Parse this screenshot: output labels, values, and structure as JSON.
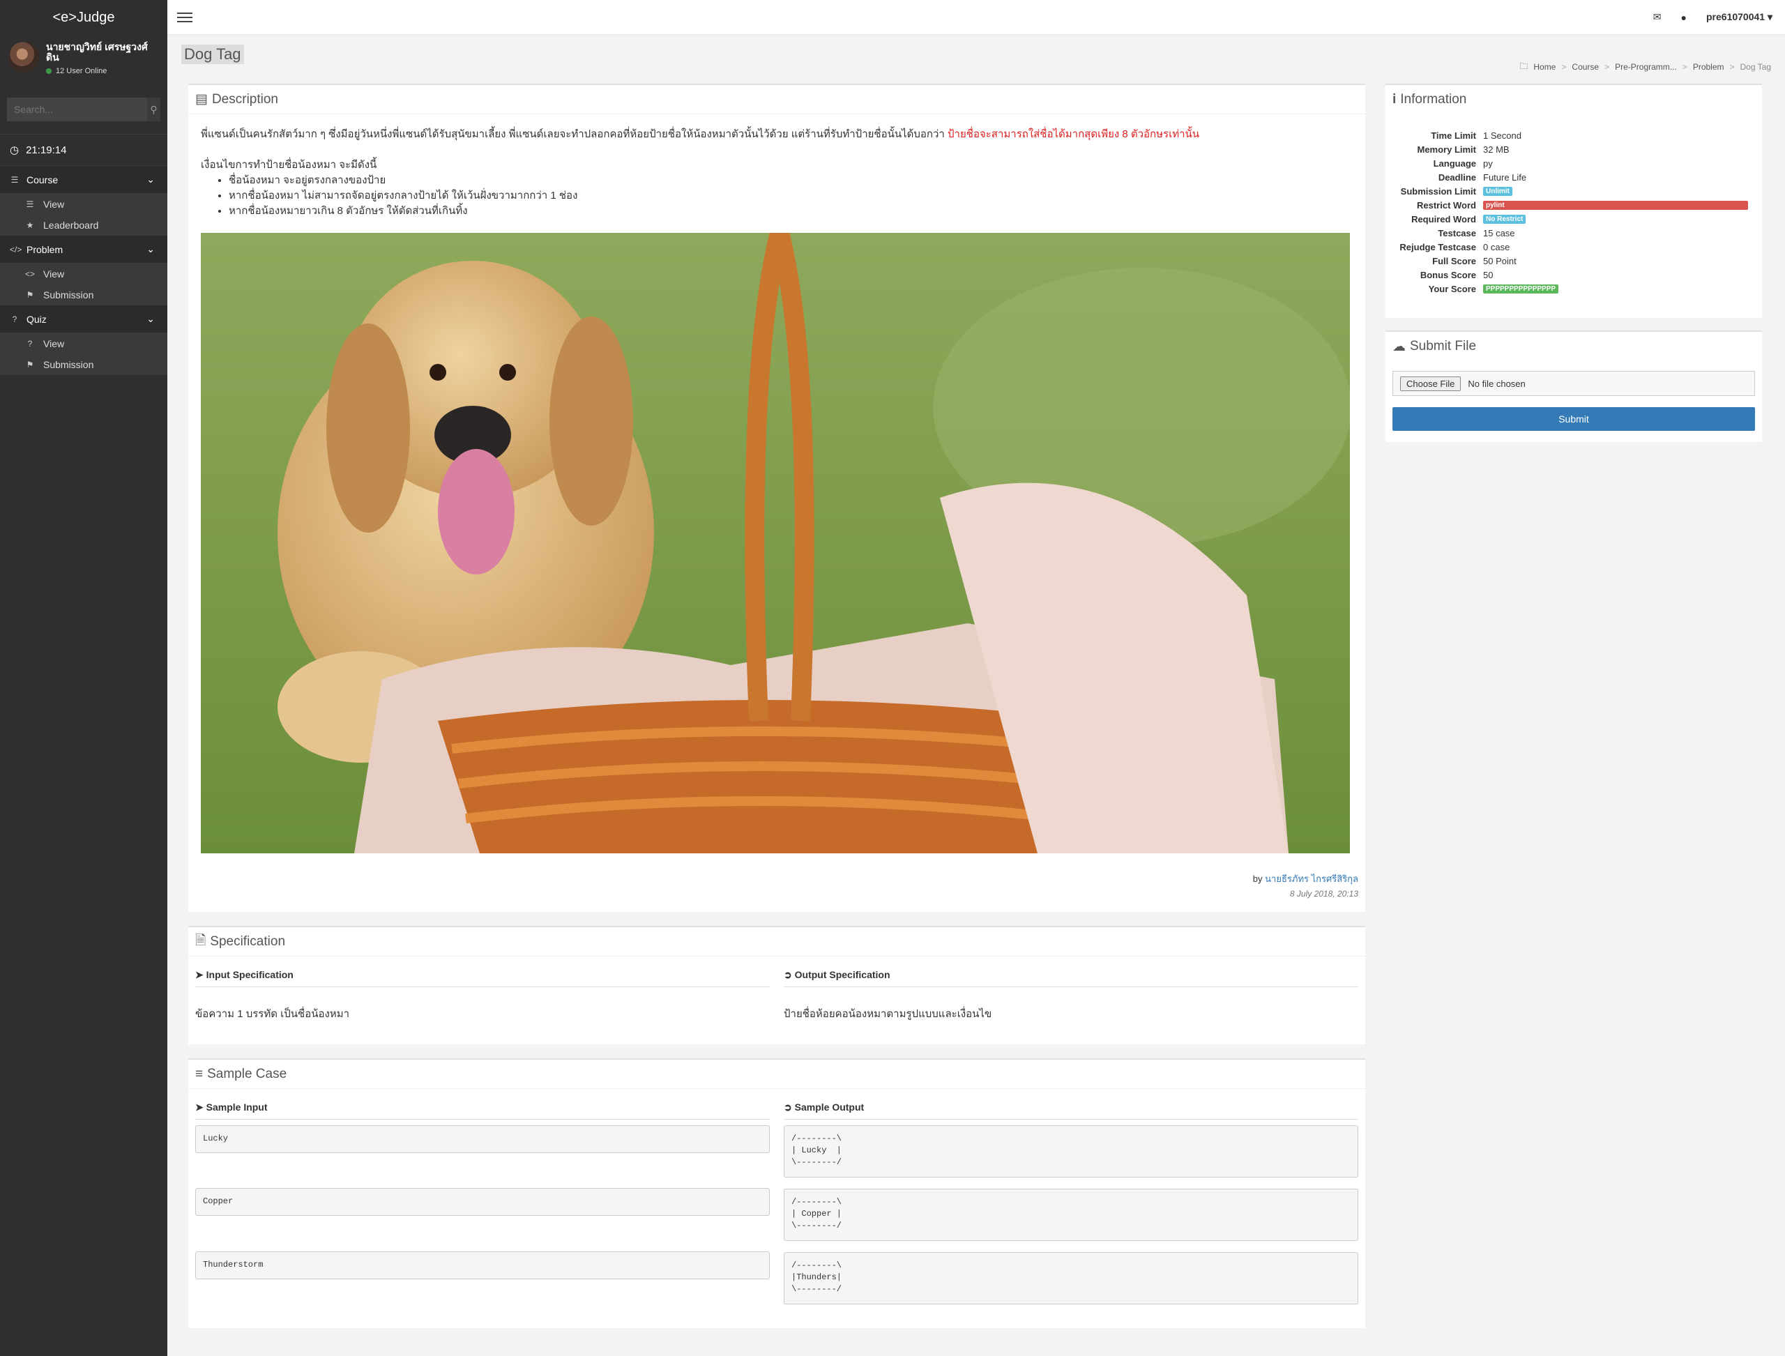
{
  "app": {
    "logo": "<e>Judge",
    "user_name": "นายชาญวิทย์ เศรษฐวงศ์ดิน",
    "online": "12 User Online",
    "search_placeholder": "Search...",
    "clock": "21:19:14"
  },
  "sidebar": {
    "groups": [
      {
        "label": "Course",
        "items": [
          "View",
          "Leaderboard"
        ]
      },
      {
        "label": "Problem",
        "items": [
          "View",
          "Submission"
        ]
      },
      {
        "label": "Quiz",
        "items": [
          "View",
          "Submission"
        ]
      }
    ]
  },
  "topbar": {
    "user": "pre61070041"
  },
  "page": {
    "title": "Dog Tag",
    "breadcrumb": [
      "Home",
      "Course",
      "Pre-Programm...",
      "Problem",
      "Dog Tag"
    ]
  },
  "description": {
    "heading": "Description",
    "intro": "พี่แซนด์เป็นคนรักสัตว์มาก ๆ ซึ่งมีอยู่วันหนึ่งพี่แซนด์ได้รับสุนัขมาเลี้ยง พี่แซนด์เลยจะทำปลอกคอที่ห้อยป้ายชื่อให้น้องหมาตัวนั้นไว้ด้วย แต่ร้านที่รับทำป้ายชื่อนั้นได้บอกว่า",
    "intro_red": "ป้ายชื่อจะสามารถใส่ชื่อได้มากสุดเพียง 8 ตัวอักษรเท่านั้น",
    "cond_title": "เงื่อนไขการทำป้ายชื่อน้องหมา จะมีดังนี้",
    "rules": [
      "ชื่อน้องหมา จะอยู่ตรงกลางของป้าย",
      "หากชื่อน้องหมา ไม่สามารถจัดอยู่ตรงกลางป้ายได้ ให้เว้นฝั่งขวามากกว่า 1 ช่อง",
      "หากชื่อน้องหมายาวเกิน 8 ตัวอักษร ให้ตัดส่วนที่เกินทิ้ง"
    ],
    "by": "by",
    "author": "นายธีรภัทร ไกรศรีสิริกุล",
    "date": "8 July 2018, 20:13"
  },
  "specification": {
    "heading": "Specification",
    "input_title": "Input Specification",
    "output_title": "Output Specification",
    "input_text": "ข้อความ 1 บรรทัด เป็นชื่อน้องหมา",
    "output_text": "ป้ายชื่อห้อยคอน้องหมาตามรูปแบบและเงื่อนไข"
  },
  "samples": {
    "heading": "Sample Case",
    "input_title": "Sample Input",
    "output_title": "Sample Output",
    "cases": [
      {
        "input": "Lucky",
        "output": "/--------\\\n| Lucky  |\n\\--------/"
      },
      {
        "input": "Copper",
        "output": "/--------\\\n| Copper |\n\\--------/"
      },
      {
        "input": "Thunderstorm",
        "output": "/--------\\\n|Thunders|\n\\--------/"
      }
    ]
  },
  "information": {
    "heading": "Information",
    "rows": [
      {
        "k": "Time Limit",
        "v": "1 Second"
      },
      {
        "k": "Memory Limit",
        "v": "32 MB"
      },
      {
        "k": "Language",
        "v": "py"
      },
      {
        "k": "Deadline",
        "v": "Future Life"
      },
      {
        "k": "Submission Limit",
        "v": "Unlimit",
        "badge": "#5bc0de"
      },
      {
        "k": "Restrict Word",
        "v": "pylint",
        "badge": "#d9534f"
      },
      {
        "k": "Required Word",
        "v": "No Restrict",
        "badge": "#5bc0de"
      },
      {
        "k": "Testcase",
        "v": "15 case"
      },
      {
        "k": "Rejudge Testcase",
        "v": "0 case"
      },
      {
        "k": "Full Score",
        "v": "50 Point"
      },
      {
        "k": "Bonus Score",
        "v": "50"
      },
      {
        "k": "Your Score",
        "v": "PPPPPPPPPPPPPPP",
        "badge": "#5cb85c"
      }
    ]
  },
  "submit": {
    "heading": "Submit File",
    "choose": "Choose File",
    "nofile": "No file chosen",
    "button": "Submit"
  }
}
